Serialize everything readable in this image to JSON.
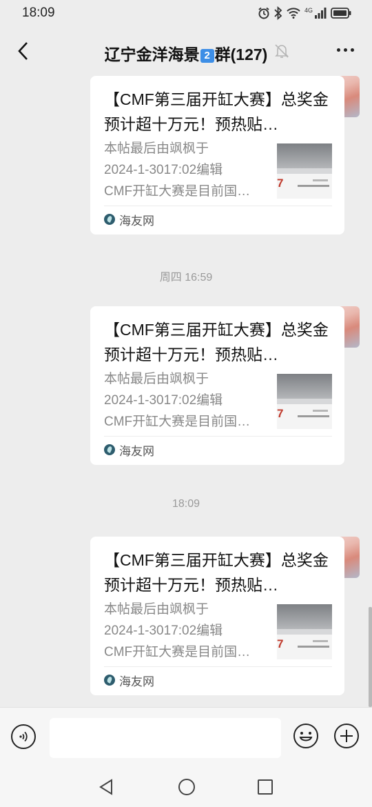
{
  "status_bar": {
    "time": "18:09",
    "network_label": "4G"
  },
  "header": {
    "title_part1": "辽宁金洋海景",
    "title_badge": "2",
    "title_part2": "群(127)",
    "muted": true
  },
  "messages": [
    {
      "title": "【CMF第三届开缸大赛】总奖金预计超十万元！预热贴…",
      "desc_line1": "本帖最后由飒枫于",
      "desc_line2": "2024-1-3017:02编辑",
      "desc_line3": "CMF开缸大赛是目前国…",
      "source": "海友网",
      "thumb_text": "7"
    },
    {
      "title": "【CMF第三届开缸大赛】总奖金预计超十万元！预热贴…",
      "desc_line1": "本帖最后由飒枫于",
      "desc_line2": "2024-1-3017:02编辑",
      "desc_line3": "CMF开缸大赛是目前国…",
      "source": "海友网",
      "thumb_text": "7"
    },
    {
      "title": "【CMF第三届开缸大赛】总奖金预计超十万元！预热贴…",
      "desc_line1": "本帖最后由飒枫于",
      "desc_line2": "2024-1-3017:02编辑",
      "desc_line3": "CMF开缸大赛是目前国…",
      "source": "海友网",
      "thumb_text": "7"
    }
  ],
  "timestamps": [
    "周四 16:59",
    "18:09"
  ],
  "input": {
    "value": "",
    "placeholder": ""
  },
  "icons": {
    "back": "back-arrow-icon",
    "mute": "bell-off-icon",
    "more": "more-dots-icon",
    "voice": "voice-icon",
    "emoji": "emoji-icon",
    "plus": "plus-icon"
  },
  "colors": {
    "background": "#ededed",
    "card": "#ffffff",
    "badge": "#3d8ee6"
  }
}
